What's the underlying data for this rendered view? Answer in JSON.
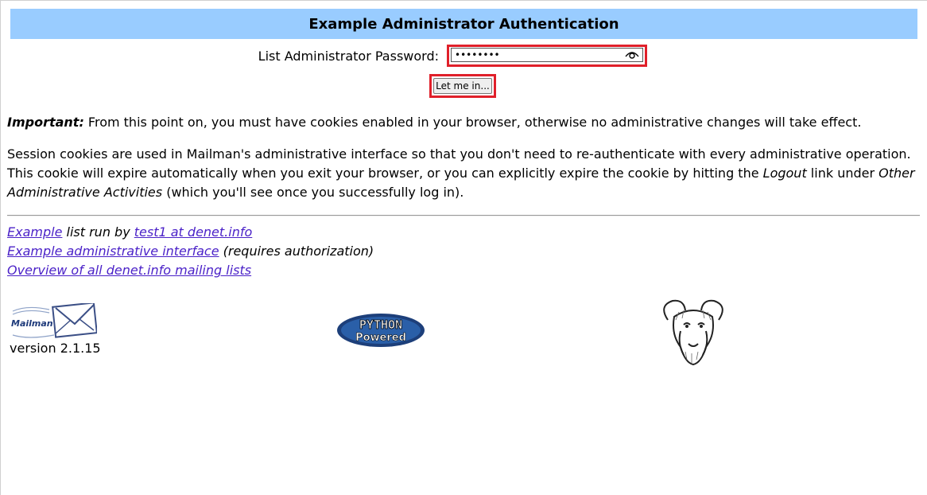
{
  "header": {
    "title": "Example Administrator Authentication"
  },
  "auth": {
    "password_label": "List Administrator Password:",
    "password_value": "••••••••",
    "login_button": "Let me in..."
  },
  "info": {
    "important_label": "Important:",
    "important_text": " From this point on, you must have cookies enabled in your browser, otherwise no administrative changes will take effect.",
    "session_part1": "Session cookies are used in Mailman's administrative interface so that you don't need to re-authenticate with every administrative operation. This cookie will expire automatically when you exit your browser, or you can explicitly expire the cookie by hitting the ",
    "logout_text": "Logout",
    "session_part2": " link under ",
    "other_activities_text": "Other Administrative Activities",
    "session_part3": " (which you'll see once you successfully log in)."
  },
  "footer": {
    "list_link": "Example",
    "run_by_text": " list run by ",
    "owner_link": "test1 at denet.info",
    "admin_link": "Example administrative interface",
    "requires_auth_text": " (requires authorization)",
    "overview_link": "Overview of all denet.info mailing lists",
    "mailman_logo_text": "Mailman",
    "version_text": "version 2.1.15",
    "python_logo_line1": "PYTHON",
    "python_logo_line2": "Powered"
  },
  "colors": {
    "title_bg": "#99ccff",
    "highlight_border": "#e0202a",
    "link": "#4b22c8"
  }
}
